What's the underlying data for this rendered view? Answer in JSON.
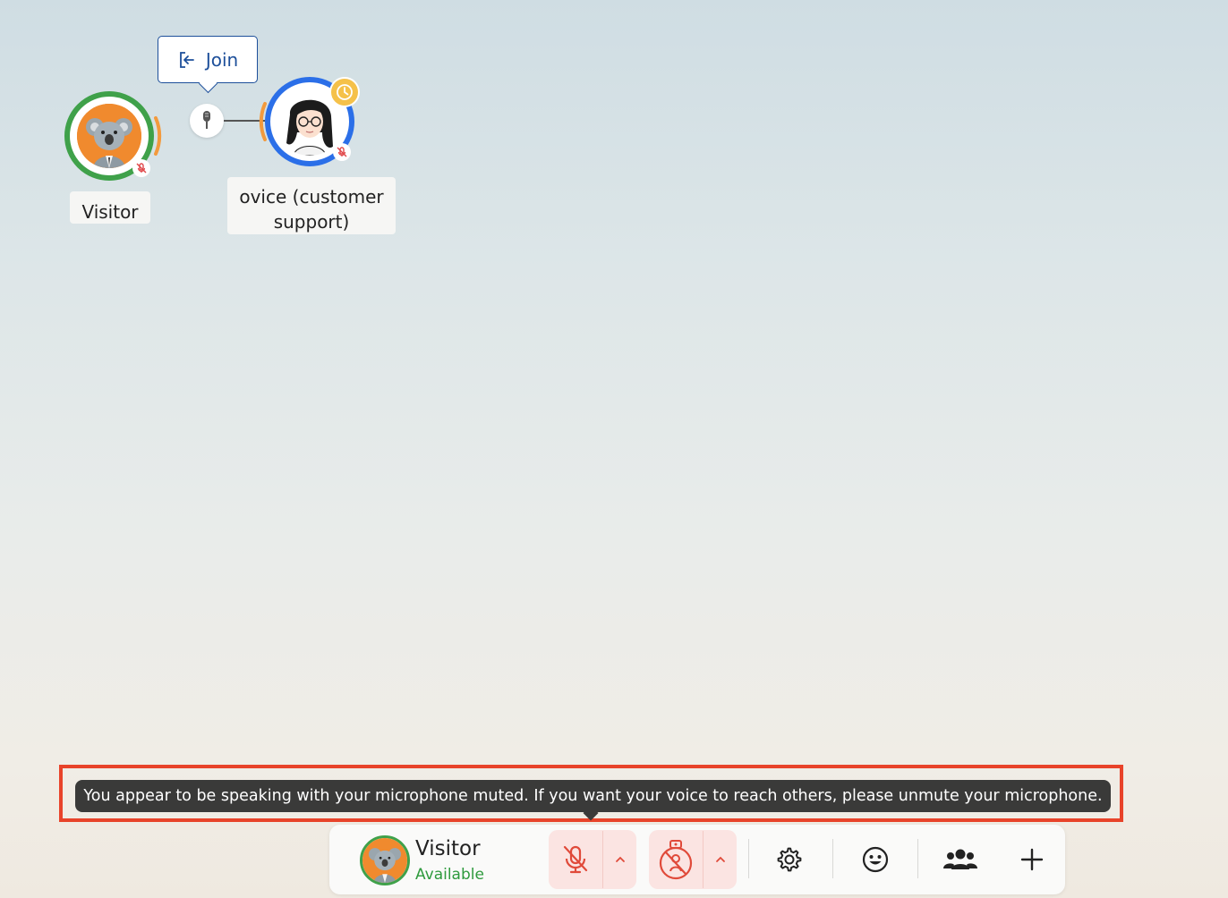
{
  "canvas": {
    "visitor_avatar": {
      "name": "Visitor",
      "ring_color": "#3fa14a",
      "speaking_color": "#f39a3d",
      "muted": true,
      "icon": "koala-avatar-icon"
    },
    "support_avatar": {
      "name": "ovice (customer support)",
      "ring_color": "#2b6fe8",
      "speaking_color": "#f39a3d",
      "muted": true,
      "status_icon": "clock-icon",
      "status_color": "#f5c14a"
    },
    "join_tooltip": {
      "label": "Join",
      "icon": "sign-in-icon"
    },
    "microphone_node": {
      "icon": "microphone-icon"
    }
  },
  "warning": {
    "message": "You appear to be speaking with your microphone muted. If you want your voice to reach others, please unmute your microphone.",
    "highlight_color": "#e8432a"
  },
  "control_bar": {
    "user_name": "Visitor",
    "user_status": "Available",
    "mic_icon": "microphone-muted-icon",
    "camera_icon": "camera-off-icon",
    "caret_icon": "chevron-up-icon",
    "settings_icon": "gear-icon",
    "emoji_icon": "smiley-icon",
    "members_icon": "users-icon",
    "add_icon": "plus-icon",
    "danger_color": "#e04a3a"
  }
}
